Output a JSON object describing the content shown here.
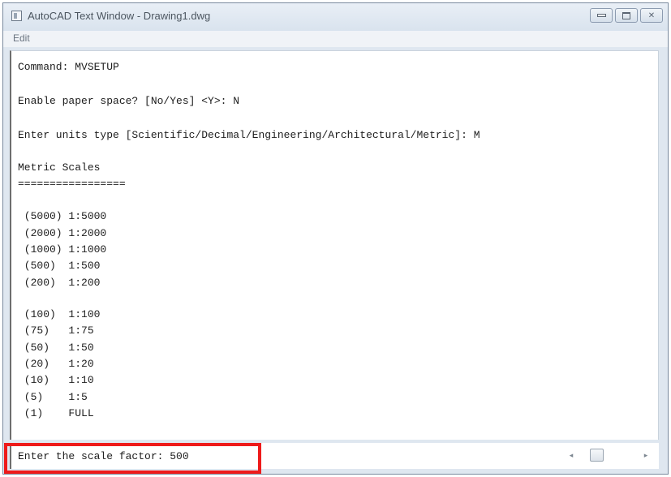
{
  "window": {
    "title": "AutoCAD Text Window - Drawing1.dwg",
    "minimize_glyph": "",
    "maximize_glyph": "",
    "close_glyph": "✕"
  },
  "menu": {
    "edit": "Edit"
  },
  "history": {
    "lines": [
      "Command: MVSETUP",
      "Enable paper space? [No/Yes] <Y>: N",
      "Enter units type [Scientific/Decimal/Engineering/Architectural/Metric]: M",
      "Metric Scales",
      "=================",
      " (5000) 1:5000",
      " (2000) 1:2000",
      " (1000) 1:1000",
      " (500)  1:500",
      " (200)  1:200",
      " (100)  1:100",
      " (75)   1:75",
      " (50)   1:50",
      " (20)   1:20",
      " (10)   1:10",
      " (5)    1:5",
      " (1)    FULL"
    ]
  },
  "command_line": {
    "text": "Enter the scale factor: 500"
  },
  "scrollbar": {
    "left_arrow": "◂",
    "right_arrow": "▸"
  },
  "colors": {
    "highlight": "#ee1b1b",
    "text": "#202020",
    "window_frame": "#dfe7f0"
  }
}
